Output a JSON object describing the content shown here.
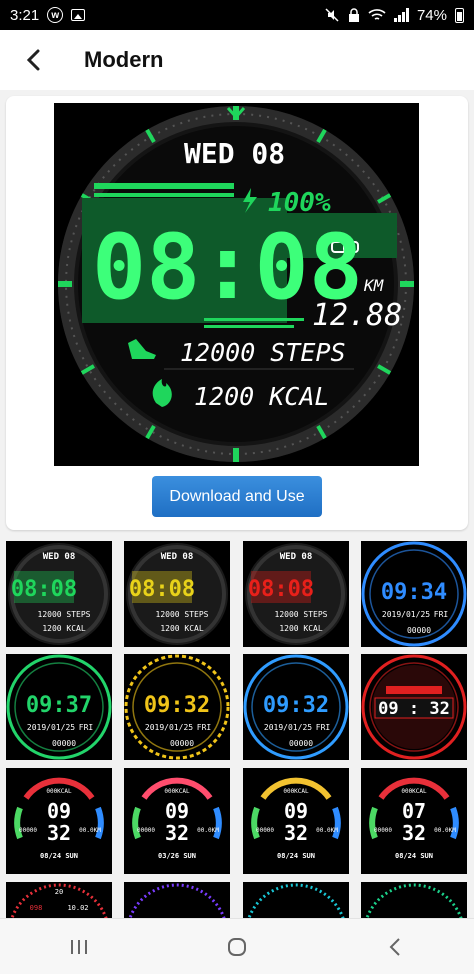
{
  "status_bar": {
    "time": "3:21",
    "battery": "74%"
  },
  "header": {
    "title": "Modern"
  },
  "preview": {
    "date": "WED 08",
    "battery": "100%",
    "time": "08:08",
    "distance_unit": "KM",
    "distance": "12.88",
    "steps": "12000 STEPS",
    "calories": "1200 KCAL",
    "accent": "#1fd65c"
  },
  "download_button": "Download and Use",
  "thumbnails": [
    {
      "name": "modern-green",
      "time": "08:08",
      "date": "WED 08",
      "l1": "12000 STEPS",
      "l2": "1200 KCAL",
      "accent": "#1fd65c"
    },
    {
      "name": "modern-yellow",
      "time": "08:08",
      "date": "WED 08",
      "l1": "12000 STEPS",
      "l2": "1200 KCAL",
      "accent": "#e8d21a"
    },
    {
      "name": "modern-red",
      "time": "08:08",
      "date": "WED 08",
      "l1": "12000 STEPS",
      "l2": "1200 KCAL",
      "accent": "#e8201a"
    },
    {
      "name": "blue-ring",
      "time": "09:34",
      "date": "2019/01/25",
      "day": "FRI",
      "l1": "00000",
      "accent": "#2f8cff"
    },
    {
      "name": "green-hex",
      "time": "09:37",
      "date": "2019/01/25",
      "day": "FRI",
      "l1": "00000",
      "accent": "#22d46a"
    },
    {
      "name": "gold-chain",
      "time": "09:32",
      "date": "2019/01/25",
      "day": "FRI",
      "l1": "00000",
      "accent": "#f0c419"
    },
    {
      "name": "blue-arcs",
      "time": "09:32",
      "date": "2019/01/25",
      "day": "FRI",
      "l1": "00000",
      "accent": "#2f9cff"
    },
    {
      "name": "red-gear",
      "time": "09 : 32",
      "date": "",
      "day": "",
      "l1": "",
      "accent": "#e02020"
    },
    {
      "name": "colorful-1",
      "time_h": "09",
      "time_m": "32",
      "top": "000KCAL",
      "left": "00000",
      "right": "00.0KM",
      "bottom": "08/24 SUN",
      "accent": "#e8303a"
    },
    {
      "name": "colorful-2",
      "time_h": "09",
      "time_m": "32",
      "top": "000KCAL",
      "left": "00000",
      "right": "00.0KM",
      "bottom": "03/26 SUN",
      "accent": "#ff4d6d"
    },
    {
      "name": "colorful-3",
      "time_h": "09",
      "time_m": "32",
      "top": "000KCAL",
      "left": "00000",
      "right": "00.0KM",
      "bottom": "08/24 SUN",
      "accent": "#f2c230"
    },
    {
      "name": "colorful-4",
      "time_h": "07",
      "time_m": "32",
      "top": "000KCAL",
      "left": "00000",
      "right": "00.0KM",
      "bottom": "08/24 SUN",
      "accent": "#e8303a"
    },
    {
      "name": "partial-1",
      "top": "20",
      "left": "098",
      "right": "10.02",
      "accent": "#e8303a"
    },
    {
      "name": "partial-2",
      "accent": "#7a3cff"
    },
    {
      "name": "partial-3",
      "accent": "#19c7d6"
    },
    {
      "name": "partial-4",
      "accent": "#1bd18a"
    }
  ]
}
